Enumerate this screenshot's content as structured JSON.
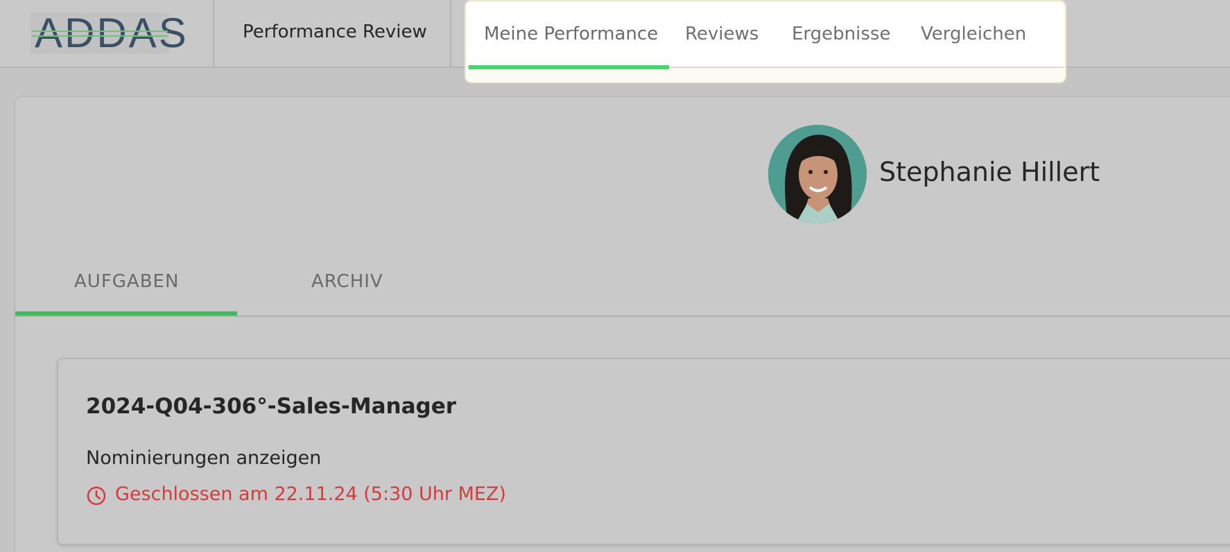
{
  "header": {
    "logo_text": "ADDAS",
    "app_title": "Performance Review",
    "nav": [
      {
        "label": "Meine Performance",
        "active": true
      },
      {
        "label": "Reviews",
        "active": false
      },
      {
        "label": "Ergebnisse",
        "active": false
      },
      {
        "label": "Vergleichen",
        "active": false
      }
    ]
  },
  "profile": {
    "name": "Stephanie Hillert",
    "avatar": "avatar-photo"
  },
  "tabs": [
    {
      "label": "AUFGABEN",
      "active": true
    },
    {
      "label": "ARCHIV",
      "active": false
    }
  ],
  "task": {
    "title": "2024-Q04-306°-Sales-Manager",
    "link_label": "Nominierungen anzeigen",
    "status_icon": "clock-icon",
    "status_text": "Geschlossen am 22.11.24 (5:30 Uhr MEZ)"
  },
  "colors": {
    "accent_green": "#4cd36b",
    "status_red": "#d63b3b"
  }
}
